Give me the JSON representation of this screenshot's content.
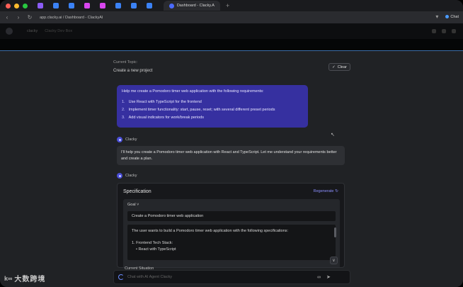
{
  "browser": {
    "tab_colors": [
      "#8b5cf6",
      "#3b82f6",
      "#3b82f6",
      "#d946ef",
      "#d946ef",
      "#3b82f6",
      "#3b82f6",
      "#3b82f6"
    ],
    "active_tab_title": "Dashboard - Clacky.AI",
    "url": "app.clacky.ai / Dashboard - ClackyAI",
    "chat_label": "Chat"
  },
  "header": {
    "crumb": "clacky",
    "crumb2": "Clacky Dev Box"
  },
  "topic": {
    "label": "Current Topic:",
    "value": "Create a new project",
    "clear_label": "Clear"
  },
  "user_message": {
    "intro": "Help me create a Pomodoro timer web application with the following requirements:",
    "items": [
      {
        "num": "1.",
        "text": "Use React with TypeScript for the frontend"
      },
      {
        "num": "2.",
        "text": "Implement timer functionality: start, pause, reset; with several different preset periods"
      },
      {
        "num": "3.",
        "text": "Add visual indicators for work/break periods"
      }
    ]
  },
  "bot": {
    "name": "Clacky",
    "reply": "I'll help you create a Pomodoro timer web application with React and TypeScript. Let me understand your requirements better and create a plan."
  },
  "spec": {
    "title": "Specification",
    "regenerate": "Regenerate",
    "goal_label": "Goal",
    "goal_value": "Create a Pomodoro timer web application",
    "desc_line1": "The user wants to build a Pomodoro timer web application with the following specifications:",
    "desc_line2": "1. Frontend Tech Stack:",
    "desc_line3": "• React with TypeScript",
    "current_situation": "Current Situation"
  },
  "input": {
    "placeholder": "Chat with AI Agent Clacky"
  },
  "watermark": {
    "text": "大数跨境"
  }
}
